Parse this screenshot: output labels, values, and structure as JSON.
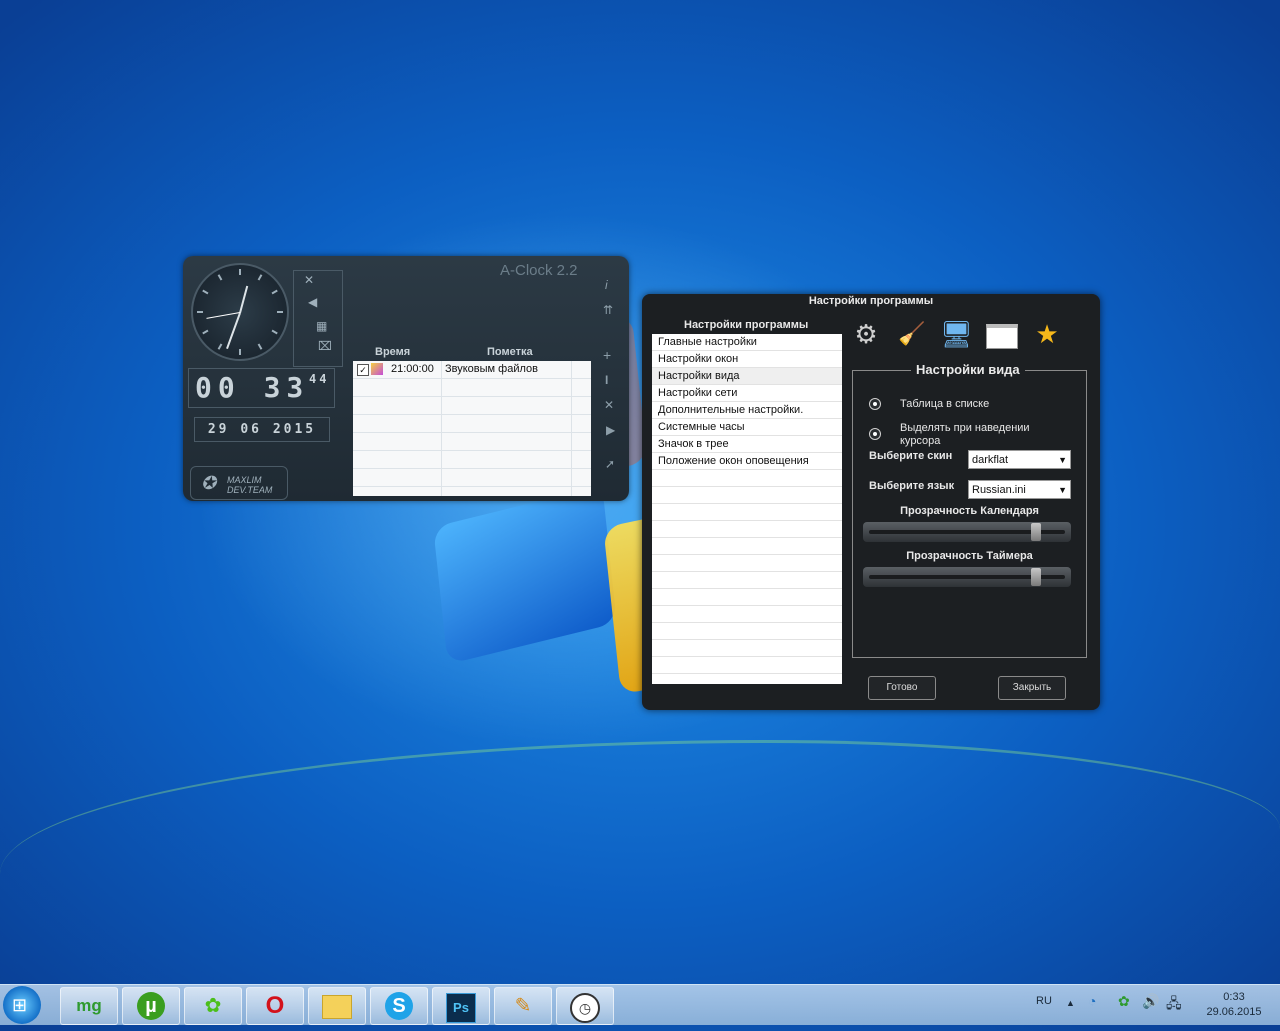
{
  "aclock": {
    "title": "A-Clock 2.2",
    "time_hm": "00 33",
    "time_sec": "44",
    "date": "29 06 2015",
    "brand_line1": "MAXLIM",
    "brand_line2": "DEV.TEAM",
    "table": {
      "col_time": "Время",
      "col_note": "Пометка",
      "rows": [
        {
          "checked": true,
          "time": "21:00:00",
          "note": "Звуковым файлов"
        }
      ]
    },
    "icons": [
      "close-icon",
      "back-icon",
      "note-icon",
      "alarm-icon",
      "info-icon",
      "pin-icon",
      "add-icon",
      "edit-icon",
      "delete-icon",
      "play-icon",
      "cursor-icon"
    ]
  },
  "settings": {
    "title": "Настройки программы",
    "list_header": "Настройки программы",
    "items": [
      "Главные настройки",
      "Настройки окон",
      "Настройки вида",
      "Настройки сети",
      "Дополнительные настройки.",
      "Системные часы",
      "Значок в трее",
      "Положение окон оповещения"
    ],
    "selected_index": 2,
    "toolbar_icons": [
      "gear-icon",
      "broom-icon",
      "monitor-icon",
      "window-icon",
      "star-icon"
    ],
    "group_title": "Настройки вида",
    "radio1": "Таблица в списке",
    "radio2": "Выделять при наведении курсора",
    "skin_label": "Выберите скин",
    "skin_value": "darkflat",
    "lang_label": "Выберите язык",
    "lang_value": "Russian.ini",
    "calendar_opacity_label": "Прозрачность Календаря",
    "calendar_opacity": 0.85,
    "timer_opacity_label": "Прозрачность Таймера",
    "timer_opacity": 0.85,
    "ok_label": "Готово",
    "close_label": "Закрыть"
  },
  "taskbar": {
    "apps": [
      "mediaget",
      "utorrent",
      "icq",
      "opera",
      "explorer",
      "skype",
      "photoshop",
      "app",
      "aclock"
    ],
    "app_labels": {
      "mediaget": "mg",
      "photoshop": "Ps"
    },
    "lang": "RU",
    "time": "0:33",
    "date": "29.06.2015"
  }
}
